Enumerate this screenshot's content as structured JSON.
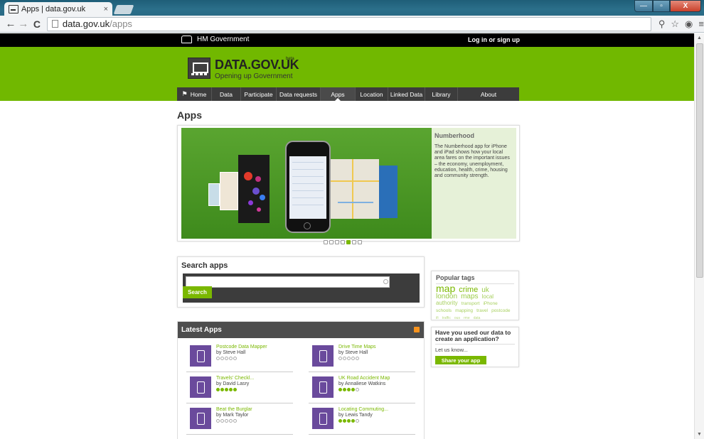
{
  "browser": {
    "tab_title": "Apps | data.gov.uk",
    "tab_close": "×",
    "url_host": "data.gov.uk",
    "url_path": "/apps",
    "back": "←",
    "forward": "→",
    "reload": "C",
    "win_min": "—",
    "win_max": "▫",
    "win_close": "X"
  },
  "govbar": {
    "name": "HM Government",
    "login": "Log in or sign up"
  },
  "brand": {
    "title": "DATA.GOV.UK",
    "beta": "beta",
    "subtitle": "Opening up Government"
  },
  "nav": {
    "items": [
      {
        "label": "Home"
      },
      {
        "label": "Data"
      },
      {
        "label": "Participate"
      },
      {
        "label": "Data requests"
      },
      {
        "label": "Apps"
      },
      {
        "label": "Location"
      },
      {
        "label": "Linked Data"
      },
      {
        "label": "Library"
      },
      {
        "label": "About"
      }
    ]
  },
  "page": {
    "title": "Apps"
  },
  "carousel": {
    "heading": "Numberhood",
    "description": "The Numberhood app for iPhone and iPad shows how your local area fares on the important issues – the economy, unemployment, education, health, crime, housing and community strength.",
    "slides": 7,
    "active_slide": 5
  },
  "search": {
    "title": "Search apps",
    "value": "",
    "placeholder": "",
    "button": "Search"
  },
  "popular_tags": {
    "title": "Popular tags",
    "tags": [
      {
        "text": "map",
        "size": "xl"
      },
      {
        "text": "crime",
        "size": "l"
      },
      {
        "text": "uk",
        "size": "m"
      },
      {
        "text": "london",
        "size": "m"
      },
      {
        "text": "maps",
        "size": "m"
      },
      {
        "text": "local authority",
        "size": "s"
      },
      {
        "text": "transport",
        "size": "xs"
      },
      {
        "text": "iPhone",
        "size": "xs"
      },
      {
        "text": "schools",
        "size": "xs"
      },
      {
        "text": "mapping",
        "size": "xs"
      },
      {
        "text": "travel",
        "size": "xs"
      },
      {
        "text": "postcode",
        "size": "xs"
      },
      {
        "text": "ifi",
        "size": "xxs"
      },
      {
        "text": "traffic",
        "size": "xxs"
      },
      {
        "text": "ous",
        "size": "xxs"
      },
      {
        "text": "rme",
        "size": "xxs"
      },
      {
        "text": "data",
        "size": "xxs"
      }
    ]
  },
  "used_data": {
    "title": "Have you used our data to create an application?",
    "text": "Let us know...",
    "button": "Share your app"
  },
  "latest_apps": {
    "title": "Latest Apps",
    "apps": [
      {
        "name": "Postcode Data Mapper",
        "author": "by Steve Hall",
        "rating": 0
      },
      {
        "name": "Drive Time Maps",
        "author": "by Steve Hall",
        "rating": 0
      },
      {
        "name": "Travels' Checkl...",
        "author": "by David Lasry",
        "rating": 5
      },
      {
        "name": "UK Road Accident Map",
        "author": "by Annaliese Watkins",
        "rating": 4
      },
      {
        "name": "Beat the Burglar",
        "author": "by Mark Taylor",
        "rating": 0
      },
      {
        "name": "Locating Commuting...",
        "author": "by Lewis Tandy",
        "rating": 4
      }
    ]
  },
  "colors": {
    "brand_green": "#7ab800",
    "header_green": "#71b800",
    "nav_dark": "#3c3c3c",
    "app_icon_purple": "#6a4a9c"
  }
}
